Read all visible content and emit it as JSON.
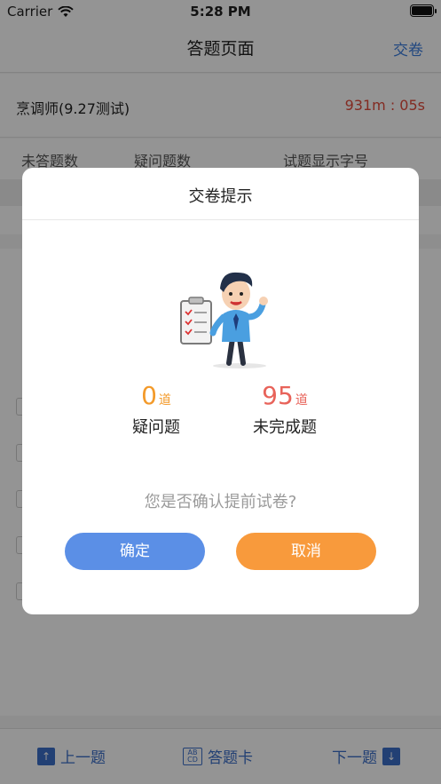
{
  "status_bar": {
    "carrier": "Carrier",
    "time": "5:28 PM"
  },
  "nav": {
    "title": "答题页面",
    "submit_label": "交卷"
  },
  "exam": {
    "name": "烹调师(9.27测试)",
    "timer": "931m : 05s"
  },
  "stats_header": {
    "col1": "未答题数",
    "col2": "疑问题数",
    "col3": "试题显示字号"
  },
  "bottom_bar": {
    "prev": "上一题",
    "card": "答题卡",
    "next": "下一题"
  },
  "dialog": {
    "title": "交卷提示",
    "doubt_count": "0",
    "doubt_unit": "道",
    "doubt_label": "疑问题",
    "unfinished_count": "95",
    "unfinished_unit": "道",
    "unfinished_label": "未完成题",
    "question": "您是否确认提前试卷?",
    "confirm_label": "确定",
    "cancel_label": "取消"
  },
  "colors": {
    "accent": "#3b7ddd",
    "timer": "#e24a3b",
    "confirm": "#5b8fe6",
    "cancel": "#f89a3c",
    "doubt": "#f39a2a",
    "unfinished": "#e8635a"
  }
}
